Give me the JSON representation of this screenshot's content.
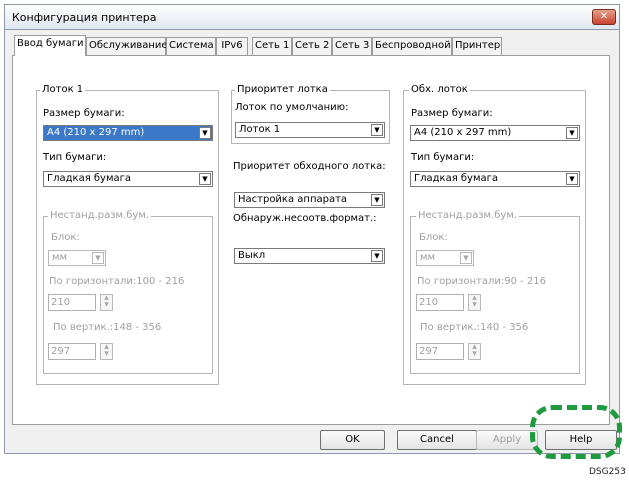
{
  "window": {
    "title": "Конфигурация принтера",
    "close_glyph": "✕"
  },
  "tabs": [
    {
      "label": "Ввод бумаги",
      "active": true
    },
    {
      "label": "Обслуживание",
      "active": false
    },
    {
      "label": "Система",
      "active": false
    },
    {
      "label": "IPv6",
      "active": false
    },
    {
      "label": "Сеть 1",
      "active": false
    },
    {
      "label": "Сеть 2",
      "active": false
    },
    {
      "label": "Сеть 3",
      "active": false
    },
    {
      "label": "Беспроводной",
      "active": false
    },
    {
      "label": "Принтер",
      "active": false
    }
  ],
  "tray1": {
    "legend": "Лоток 1",
    "paper_size_label": "Размер бумаги:",
    "paper_size_value": "A4 (210 x 297 mm)",
    "paper_type_label": "Тип бумаги:",
    "paper_type_value": "Гладкая бумага",
    "custom": {
      "legend": "Нестанд.разм.бум.",
      "unit_label": "Блок:",
      "unit_value": "мм",
      "horizontal_label": "По горизонтали:100 - 216",
      "horizontal_value": "210",
      "vertical_label": "По вертик.:148 - 356",
      "vertical_value": "297"
    }
  },
  "priority": {
    "legend": "Приоритет лотка",
    "default_tray_label": "Лоток по умолчанию:",
    "default_tray_value": "Лоток 1",
    "bypass_priority_label": "Приоритет обходного лотка:",
    "bypass_priority_value": "Настройка аппарата",
    "mismatch_label": "Обнаруж.несоотв.формат.:",
    "mismatch_value": "Выкл"
  },
  "bypass": {
    "legend": "Обх. лоток",
    "paper_size_label": "Размер бумаги:",
    "paper_size_value": "A4 (210 x 297 mm)",
    "paper_type_label": "Тип бумаги:",
    "paper_type_value": "Гладкая бумага",
    "custom": {
      "legend": "Нестанд.разм.бум.",
      "unit_label": "Блок:",
      "unit_value": "мм",
      "horizontal_label": "По горизонтали:90 - 216",
      "horizontal_value": "210",
      "vertical_label": "По вертик.:140 - 356",
      "vertical_value": "297"
    }
  },
  "buttons": {
    "ok": "OK",
    "cancel": "Cancel",
    "apply": "Apply",
    "help": "Help"
  },
  "figure_id": "DSG253",
  "colors": {
    "highlight": "#1e9b3e",
    "selection": "#3b78c8",
    "close_button": "#c8452f"
  }
}
